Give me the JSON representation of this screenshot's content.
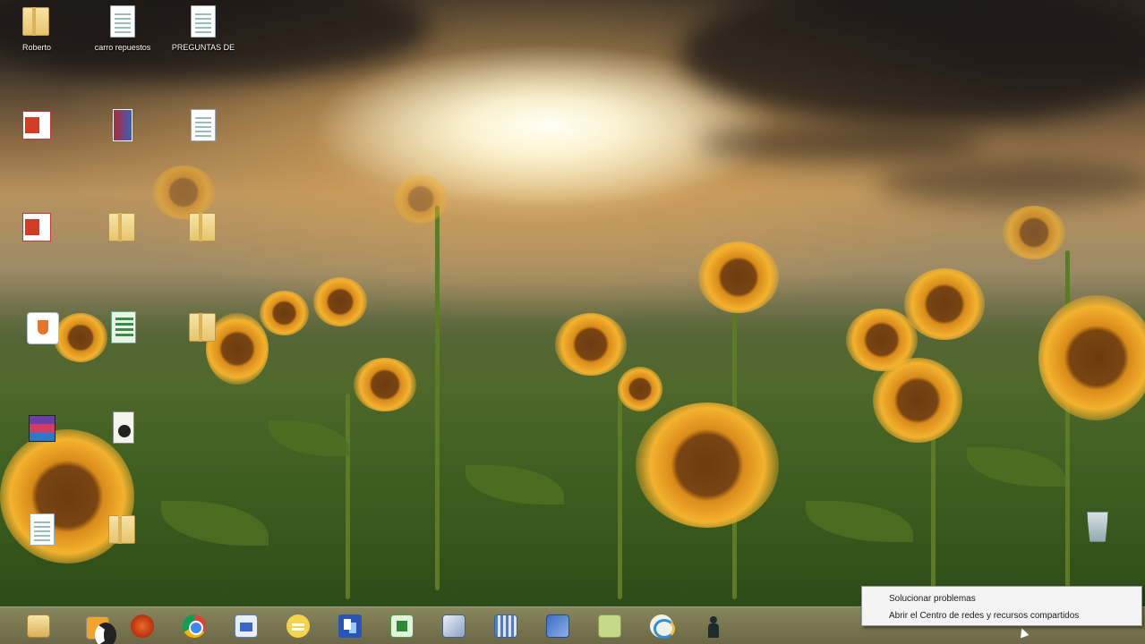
{
  "desktop": {
    "icons": [
      {
        "name": "roberto",
        "label": "Roberto",
        "type": "folder"
      },
      {
        "name": "carro-repuestos",
        "label": "carro repuestos",
        "type": "doc"
      },
      {
        "name": "preguntas",
        "label": "PREGUNTAS DE",
        "type": "doc"
      },
      {
        "name": "office-1",
        "label": "",
        "type": "office"
      },
      {
        "name": "book",
        "label": "",
        "type": "book"
      },
      {
        "name": "doc-2",
        "label": "",
        "type": "doc"
      },
      {
        "name": "office-2",
        "label": "",
        "type": "office"
      },
      {
        "name": "folder-2",
        "label": "",
        "type": "folder"
      },
      {
        "name": "folder-3",
        "label": "",
        "type": "folder"
      },
      {
        "name": "java-app",
        "label": "",
        "type": "java"
      },
      {
        "name": "sheet",
        "label": "",
        "type": "xls"
      },
      {
        "name": "folder-4",
        "label": "",
        "type": "folder"
      },
      {
        "name": "winrar",
        "label": "",
        "type": "winrar"
      },
      {
        "name": "media-file",
        "label": "",
        "type": "media"
      },
      {
        "name": "doc-3",
        "label": "",
        "type": "doc"
      },
      {
        "name": "folder-5",
        "label": "",
        "type": "folder"
      },
      {
        "name": "recycle-bin",
        "label": "",
        "type": "recycle"
      }
    ]
  },
  "taskbar": {
    "apps": [
      {
        "name": "file-explorer",
        "icon": "folder-icon",
        "style": "explorer"
      },
      {
        "name": "media-player",
        "icon": "play-icon",
        "style": "media"
      },
      {
        "name": "app-red",
        "icon": "red-circle-icon",
        "style": "redcircle"
      },
      {
        "name": "chrome",
        "icon": "chrome-icon",
        "style": "chrome"
      },
      {
        "name": "document-app",
        "icon": "document-icon",
        "style": "doc2"
      },
      {
        "name": "chat-app",
        "icon": "chat-icon",
        "style": "chat"
      },
      {
        "name": "network-app",
        "icon": "network-icon",
        "style": "network"
      },
      {
        "name": "spreadsheet-app",
        "icon": "spreadsheet-icon",
        "style": "green"
      },
      {
        "name": "cube-app",
        "icon": "cube-icon",
        "style": "cube"
      },
      {
        "name": "grid-app",
        "icon": "grid-icon",
        "style": "qr"
      },
      {
        "name": "virtualbox",
        "icon": "virtualbox-icon",
        "style": "vbox"
      },
      {
        "name": "notes-app",
        "icon": "notes-icon",
        "style": "notes"
      },
      {
        "name": "internet-explorer",
        "icon": "ie-icon",
        "style": "ie"
      },
      {
        "name": "person-app",
        "icon": "person-icon",
        "style": "person"
      }
    ]
  },
  "context_menu": {
    "items": [
      {
        "name": "troubleshoot",
        "label": "Solucionar problemas"
      },
      {
        "name": "network-center",
        "label": "Abrir el Centro de redes y recursos compartidos"
      }
    ]
  }
}
